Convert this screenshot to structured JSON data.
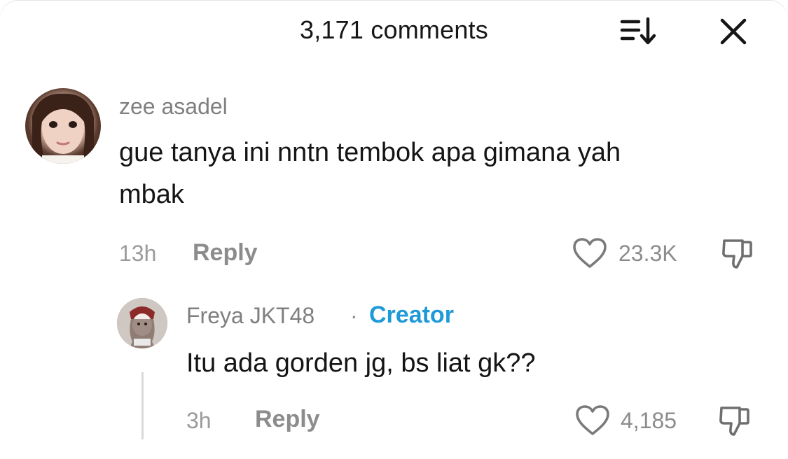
{
  "header": {
    "title": "3,171 comments",
    "sort_icon": "sort-down-icon",
    "close_icon": "close-icon"
  },
  "comments": [
    {
      "username": "zee asadel",
      "text_line1": "gue tanya ini nntn tembok apa gimana yah",
      "text_line2": "mbak",
      "time": "13h",
      "reply_label": "Reply",
      "likes": "23.3K"
    }
  ],
  "reply": {
    "username": "Freya JKT48",
    "separator": "·",
    "badge": "Creator",
    "text": "Itu ada gorden jg, bs liat gk??",
    "time": "3h",
    "reply_label": "Reply",
    "likes": "4,185"
  },
  "colors": {
    "creator_badge": "#1f9ad8",
    "meta_text": "#8c8c8c",
    "body_text": "#151515"
  }
}
